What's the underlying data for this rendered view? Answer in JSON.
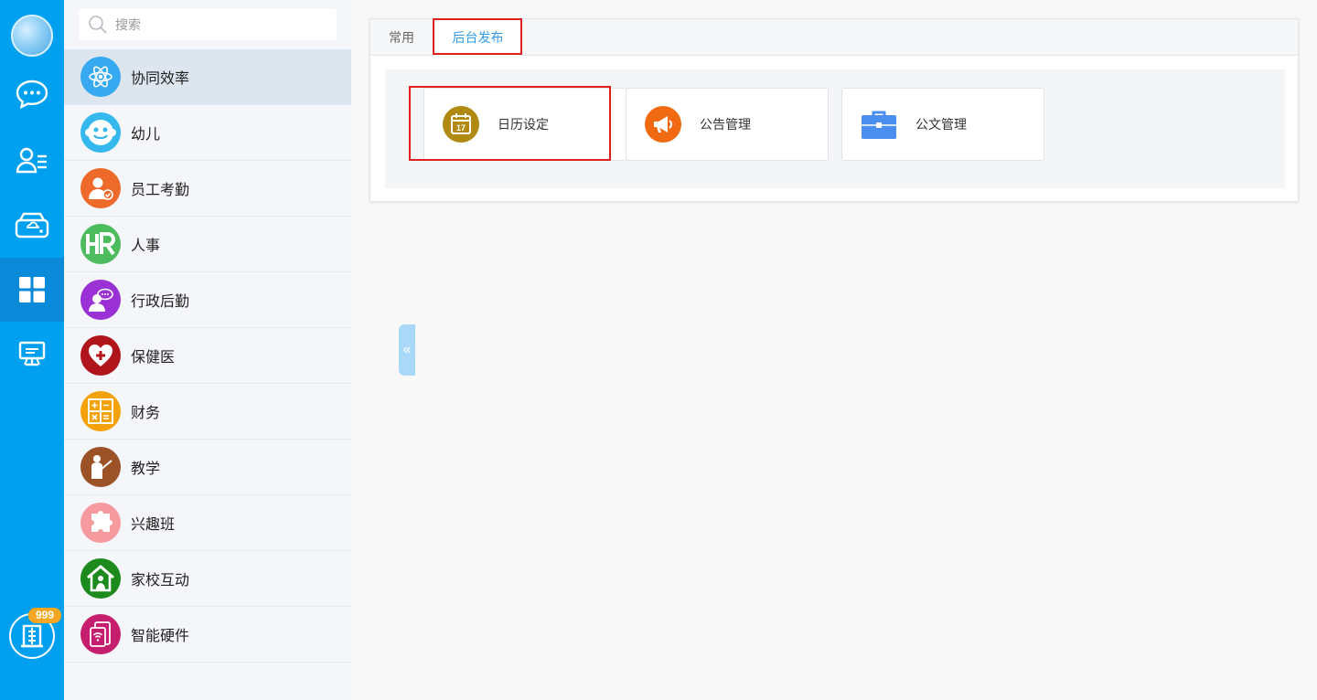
{
  "rail": {
    "items": [
      "chat-icon",
      "contacts-icon",
      "cloud-drive-icon",
      "apps-icon",
      "desktop-icon"
    ],
    "badge": "999"
  },
  "sidebar": {
    "search_placeholder": "搜索",
    "items": [
      {
        "label": "协同效率",
        "color": "#36a9f0"
      },
      {
        "label": "幼儿",
        "color": "#34b8ee"
      },
      {
        "label": "员工考勤",
        "color": "#ee6a2b"
      },
      {
        "label": "人事",
        "color": "#4cbc5e"
      },
      {
        "label": "行政后勤",
        "color": "#9a31d4"
      },
      {
        "label": "保健医",
        "color": "#b0151b"
      },
      {
        "label": "财务",
        "color": "#f4a20c"
      },
      {
        "label": "教学",
        "color": "#9b5226"
      },
      {
        "label": "兴趣班",
        "color": "#f79aa0"
      },
      {
        "label": "家校互动",
        "color": "#1d8a1e"
      },
      {
        "label": "智能硬件",
        "color": "#c61e6e"
      }
    ]
  },
  "tabs": [
    "常用",
    "后台发布"
  ],
  "cards": [
    {
      "label": "日历设定",
      "color": "#b08a10",
      "icon": "calendar-icon"
    },
    {
      "label": "公告管理",
      "color": "#f06a12",
      "icon": "megaphone-icon"
    },
    {
      "label": "公文管理",
      "color": "#4a8ff0",
      "icon": "briefcase-icon"
    }
  ],
  "colors": {
    "rail": "#00a0f0",
    "accent": "#2f9be8",
    "highlight": "#e0201f"
  }
}
